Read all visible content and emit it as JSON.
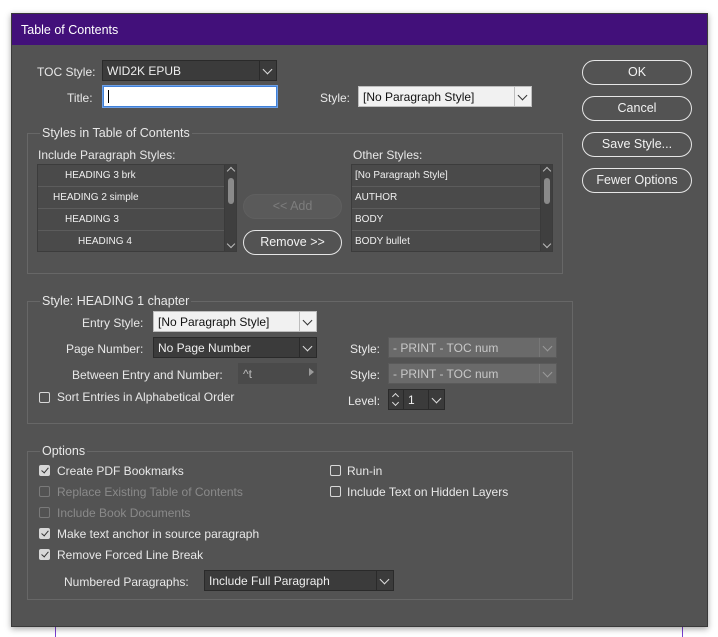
{
  "dialog": {
    "title": "Table of Contents"
  },
  "toc_style": {
    "label": "TOC Style:",
    "value": "WID2K EPUB"
  },
  "title_field": {
    "label": "Title:",
    "value": ""
  },
  "title_style": {
    "label": "Style:",
    "value": "[No Paragraph Style]"
  },
  "buttons": {
    "ok": "OK",
    "cancel": "Cancel",
    "save_style": "Save Style...",
    "fewer_options": "Fewer Options"
  },
  "styles_group": {
    "title": "Styles in Table of Contents",
    "include_label": "Include Paragraph Styles:",
    "include_items": [
      "HEADING 3 brk",
      "HEADING 2 simple",
      "HEADING 3",
      "HEADING 4"
    ],
    "add_label": "<< Add",
    "remove_label": "Remove >>",
    "other_label": "Other Styles:",
    "other_items": [
      "[No Paragraph Style]",
      "AUTHOR",
      "BODY",
      "BODY bullet"
    ]
  },
  "style_group": {
    "title": "Style: HEADING 1 chapter",
    "entry_style_label": "Entry Style:",
    "entry_style_value": "[No Paragraph Style]",
    "page_number_label": "Page Number:",
    "page_number_value": "No Page Number",
    "page_number_style_label": "Style:",
    "page_number_style_value": "- PRINT - TOC num",
    "between_label": "Between Entry and Number:",
    "between_value": "^t",
    "between_style_label": "Style:",
    "between_style_value": "- PRINT - TOC num",
    "sort_label": "Sort Entries in Alphabetical Order",
    "sort_checked": false,
    "level_label": "Level:",
    "level_value": "1"
  },
  "options_group": {
    "title": "Options",
    "create_pdf_bookmarks": "Create PDF Bookmarks",
    "replace_existing": "Replace Existing Table of Contents",
    "include_book_documents": "Include Book Documents",
    "make_text_anchor": "Make text anchor in source paragraph",
    "remove_forced_line_break": "Remove Forced Line Break",
    "run_in": "Run-in",
    "include_hidden_layers": "Include Text on Hidden Layers",
    "numbered_paragraphs_label": "Numbered Paragraphs:",
    "numbered_paragraphs_value": "Include Full Paragraph"
  },
  "colors": {
    "titlebar": "#42107a",
    "dialog_bg": "#535353",
    "focus": "#3f80d8"
  }
}
